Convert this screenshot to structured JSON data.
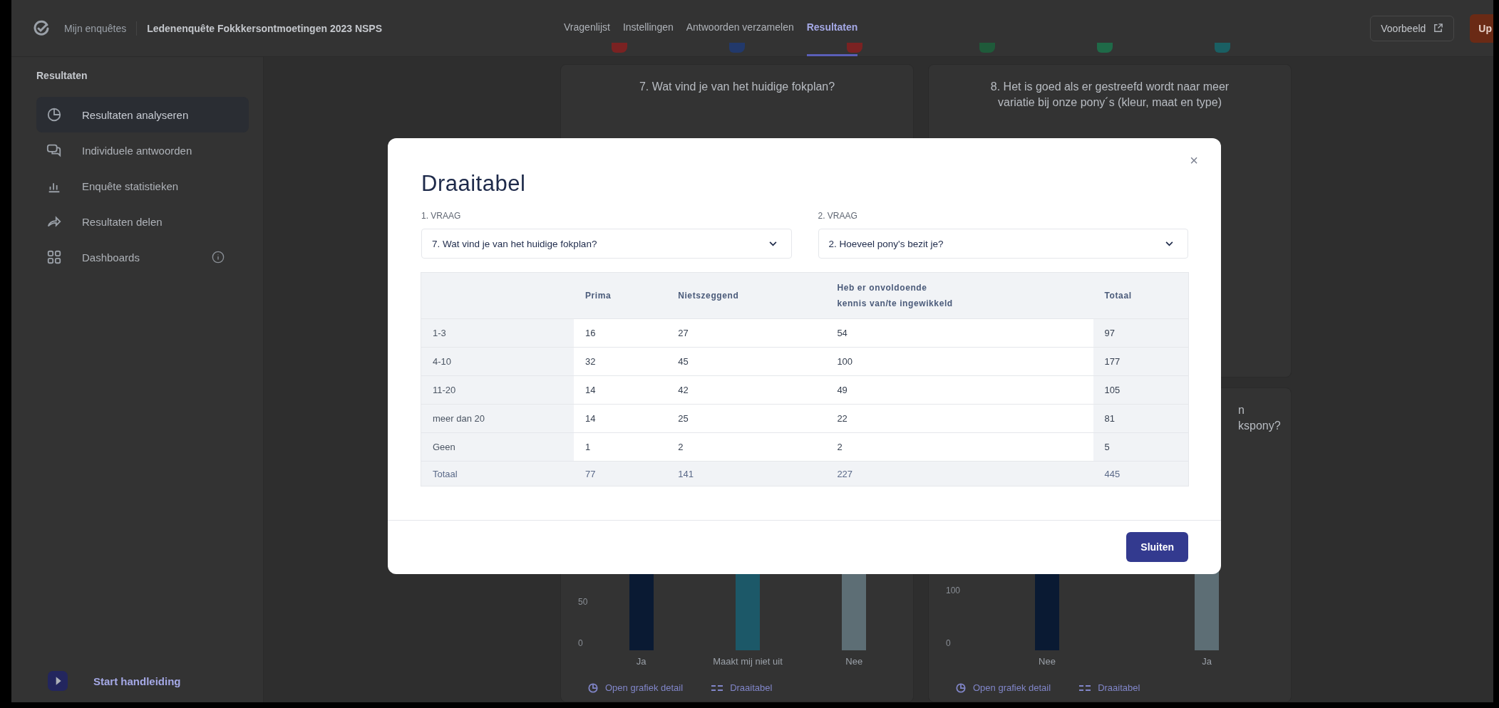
{
  "topbar": {
    "breadcrumb": "Mijn enquêtes",
    "survey_title": "Ledenenquête Fokkkersontmoetingen 2023 NSPS",
    "tabs": [
      {
        "label": "Vragenlijst",
        "selected": false
      },
      {
        "label": "Instellingen",
        "selected": false
      },
      {
        "label": "Antwoorden verzamelen",
        "selected": false
      },
      {
        "label": "Resultaten",
        "selected": true
      }
    ],
    "preview_button": "Voorbeeld",
    "action_button": "Up"
  },
  "sidebar": {
    "heading": "Resultaten",
    "items": [
      {
        "label": "Resultaten analyseren",
        "selected": true,
        "info": false
      },
      {
        "label": "Individuele antwoorden",
        "selected": false,
        "info": false
      },
      {
        "label": "Enquête statistieken",
        "selected": false,
        "info": false
      },
      {
        "label": "Resultaten delen",
        "selected": false,
        "info": false
      },
      {
        "label": "Dashboards",
        "selected": false,
        "info": true
      }
    ],
    "footer_link": "Start handleiding"
  },
  "marker_rows": [
    {
      "markers": [
        {
          "color": "#7a2222"
        },
        {
          "color": "#22396b"
        },
        {
          "color": "#7a2222"
        }
      ]
    },
    {
      "markers": [
        {
          "color": "#1f5a3a"
        },
        {
          "color": "#1f6a48"
        },
        {
          "color": "#1a5f63"
        }
      ]
    }
  ],
  "cards": [
    {
      "title_lines": [
        "7. Wat vind je van het huidige fokplan?"
      ]
    },
    {
      "title_lines": [
        "8. Het is goed als er gestreefd wordt naar meer",
        "variatie bij onze pony´s (kleur, maat en type)"
      ]
    },
    {
      "ticks": [
        "50",
        "0"
      ],
      "categories": [
        {
          "label": "Ja",
          "color": "#0a1a33"
        },
        {
          "label": "Maakt mij niet uit",
          "color": "#1c5868"
        },
        {
          "label": "Nee",
          "color": "#5d6e75"
        }
      ],
      "links": [
        "Open grafiek detail",
        "Draaitabel"
      ]
    },
    {
      "title_lines": [
        "n",
        "kspony?"
      ],
      "ticks": [
        "100",
        "0"
      ],
      "categories": [
        {
          "label": "Nee",
          "color": "#0a1a33"
        },
        {
          "label": "Ja",
          "color": "#5d6e75"
        }
      ],
      "links": [
        "Open grafiek detail",
        "Draaitabel"
      ]
    }
  ],
  "dialog": {
    "title": "Draaitabel",
    "close_glyph": "×",
    "questions": [
      {
        "label": "1. VRAAG",
        "value": "7. Wat vind je van het huidige fokplan?"
      },
      {
        "label": "2. VRAAG",
        "value": "2. Hoeveel pony's bezit je?"
      }
    ],
    "table": {
      "columns": [
        "Prima",
        "Nietszeggend",
        "Heb er onvoldoende kennis van/te ingewikkeld",
        "Totaal"
      ],
      "rows": [
        {
          "kind": "data",
          "label": "1-3",
          "cells": [
            "16",
            "27",
            "54",
            "97"
          ]
        },
        {
          "kind": "data",
          "label": "4-10",
          "cells": [
            "32",
            "45",
            "100",
            "177"
          ]
        },
        {
          "kind": "data",
          "label": "11-20",
          "cells": [
            "14",
            "42",
            "49",
            "105"
          ]
        },
        {
          "kind": "data",
          "label": "meer dan 20",
          "cells": [
            "14",
            "25",
            "22",
            "81"
          ]
        },
        {
          "kind": "data",
          "label": "Geen",
          "cells": [
            "1",
            "2",
            "2",
            "5"
          ]
        },
        {
          "kind": "total",
          "label": "Totaal",
          "cells": [
            "77",
            "141",
            "227",
            "445"
          ]
        }
      ]
    },
    "close_button": "Sluiten"
  }
}
